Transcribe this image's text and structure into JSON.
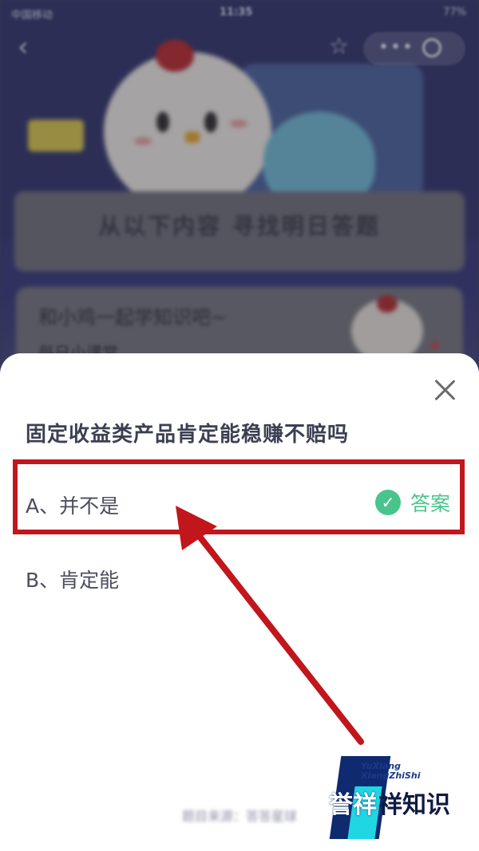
{
  "status_bar": {
    "carrier": "中国移动",
    "time": "11:35",
    "battery": "77%"
  },
  "nav": {
    "back_icon": "‹",
    "star_icon": "☆",
    "more_icon": "•••"
  },
  "background": {
    "header_text": "从以下内容 寻找明日答题",
    "lesson_title": "和小鸡一起学知识吧~",
    "lesson_subtitle": "每日小课堂"
  },
  "quiz": {
    "question": "固定收益类产品肯定能稳赚不赔吗",
    "options": [
      {
        "label": "A、并不是",
        "is_answer": true
      },
      {
        "label": "B、肯定能",
        "is_answer": false
      }
    ],
    "answer_label": "答案",
    "check_icon": "✓",
    "bottom_hint": "题目来源：答答星球"
  },
  "colors": {
    "accent_green": "#49c48c",
    "highlight_red": "#c1161c",
    "question_text": "#3c3f52"
  },
  "watermark": {
    "line1": "YuXiang",
    "line2": "XiangZhiShi",
    "brand": "誉祥",
    "brand_suffix": "祥知识"
  }
}
